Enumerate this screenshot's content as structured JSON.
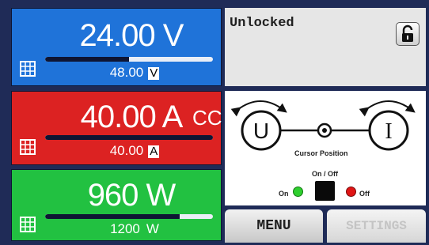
{
  "voltage": {
    "actual": "24.00 V",
    "set_value": "48.00",
    "set_unit": "V",
    "bar_fraction": 0.5
  },
  "current": {
    "actual": "40.00 A",
    "mode": "CC",
    "set_value": "40.00",
    "set_unit": "A",
    "bar_fraction": 1.0
  },
  "power": {
    "actual": "960 W",
    "set_value": "1200",
    "set_unit": "W",
    "bar_fraction": 0.8
  },
  "status": {
    "text": "Unlocked",
    "lock_icon": "padlock-unlocked-icon"
  },
  "control": {
    "left_knob": "U",
    "right_knob": "I",
    "cursor_label": "Cursor Position",
    "onoff_label": "On / Off",
    "on_label": "On",
    "off_label": "Off",
    "on_color": "#2fcf2f",
    "off_color": "#e01515"
  },
  "buttons": {
    "menu": "MENU",
    "settings": "SETTINGS"
  },
  "colors": {
    "voltage_panel": "#1f73d9",
    "current_panel": "#dc2222",
    "power_panel": "#22c141",
    "background": "#1f2b57"
  }
}
